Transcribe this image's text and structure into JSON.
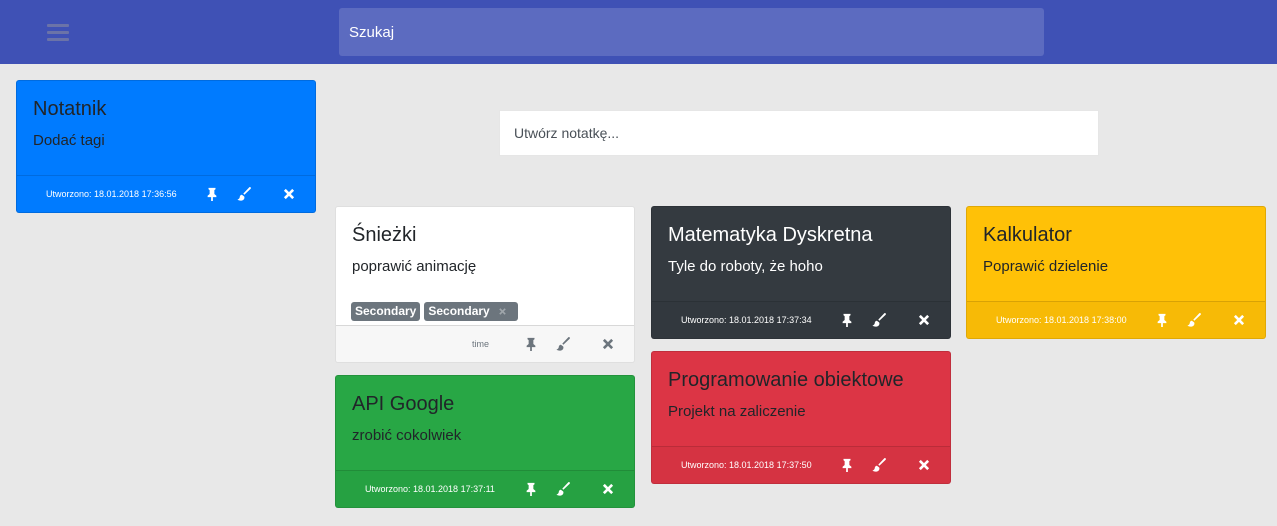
{
  "header": {
    "search_placeholder": "Szukaj"
  },
  "create_note": {
    "placeholder": "Utwórz notatkę..."
  },
  "notes": {
    "notatnik": {
      "title": "Notatnik",
      "text": "Dodać tagi",
      "created": "Utworzono: 18.01.2018 17:36:56",
      "color": "#007bff"
    },
    "sniezki": {
      "title": "Śnieżki",
      "text": "poprawić animację",
      "created": "time",
      "color": "#ffffff",
      "tags": [
        "Secondary",
        "Secondary"
      ]
    },
    "matematyka": {
      "title": "Matematyka Dyskretna",
      "text": "Tyle do roboty, że hoho",
      "created": "Utworzono: 18.01.2018 17:37:34",
      "color": "#343a40"
    },
    "kalkulator": {
      "title": "Kalkulator",
      "text": "Poprawić dzielenie",
      "created": "Utworzono: 18.01.2018 17:38:00",
      "color": "#ffc107"
    },
    "api_google": {
      "title": "API Google",
      "text": "zrobić cokolwiek",
      "created": "Utworzono: 18.01.2018 17:37:11",
      "color": "#28a745"
    },
    "programowanie": {
      "title": "Programowanie obiektowe",
      "text": "Projekt na zaliczenie",
      "created": "Utworzono: 18.01.2018 17:37:50",
      "color": "#dc3545"
    }
  },
  "icons": {
    "menu": "hamburger-icon",
    "pin": "pin-icon",
    "paint": "paintbrush-icon",
    "delete": "close-icon"
  }
}
